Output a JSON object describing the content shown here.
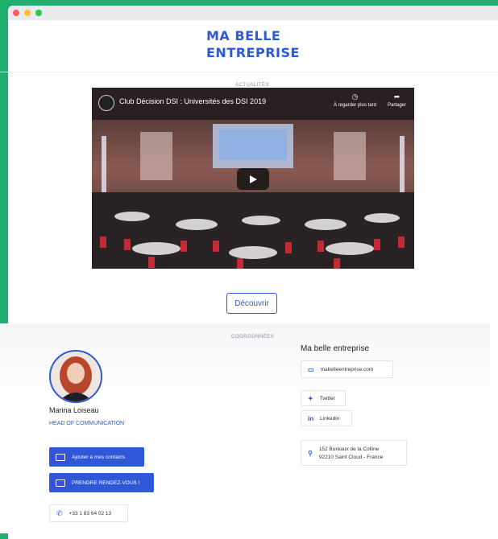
{
  "brand": {
    "line1": "MA BELLE",
    "line2": "ENTREPRISE",
    "color": "#2f58d8"
  },
  "news": {
    "label": "ACTUALITÉS",
    "video_title": "Club Décision DSI : Universités des DSI 2019",
    "watch_later": "À regarder plus tard",
    "share": "Partager",
    "discover_label": "Découvrir"
  },
  "contact": {
    "label": "COORDONNÉES",
    "name": "Marina Loiseau",
    "role": "HEAD OF COMMUNICATION",
    "add_contact_label": "Ajouter à mes contacts",
    "appointment_label": "PRENDRE RENDEZ-VOUS !",
    "phone": "+33 1 83 64 02 13"
  },
  "company": {
    "name": "Ma belle entreprise",
    "website": "mabelleentreprise.com",
    "twitter": "Twitter",
    "linkedin": "Linkedin",
    "address_line1": "152 Bureaux de la Colline",
    "address_line2": "92210 Saint Cloud - France"
  },
  "colors": {
    "background": "#1fae6e",
    "accent": "#2f58d8"
  }
}
